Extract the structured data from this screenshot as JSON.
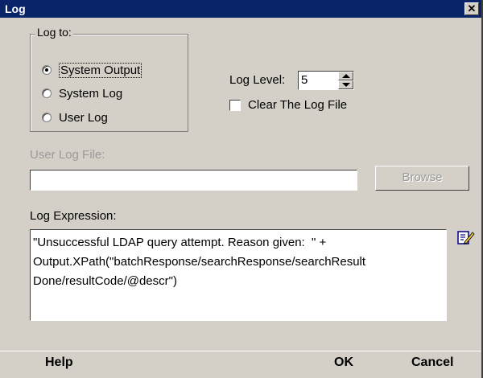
{
  "window": {
    "title": "Log",
    "close_glyph": "✕"
  },
  "log_to": {
    "legend": "Log to:",
    "options": [
      {
        "label": "System Output",
        "checked": true
      },
      {
        "label": "System Log",
        "checked": false
      },
      {
        "label": "User Log",
        "checked": false
      }
    ]
  },
  "log_level": {
    "label": "Log Level:",
    "value": "5"
  },
  "clear_log": {
    "label": "Clear The Log File",
    "checked": false
  },
  "user_log_file": {
    "label": "User Log File:",
    "value": "",
    "browse_label": "Browse"
  },
  "log_expression": {
    "label": "Log Expression:",
    "value": "\"Unsuccessful LDAP query attempt. Reason given:  \" +\nOutput.XPath(\"batchResponse/searchResponse/searchResult\nDone/resultCode/@descr\")",
    "edit_icon": "edit-pencil-icon"
  },
  "footer": {
    "help_label": "Help",
    "ok_label": "OK",
    "cancel_label": "Cancel"
  },
  "colors": {
    "dialog_bg": "#d4d0c8",
    "titlebar_bg": "#0a246a",
    "disabled_text": "#9a9a9a"
  }
}
